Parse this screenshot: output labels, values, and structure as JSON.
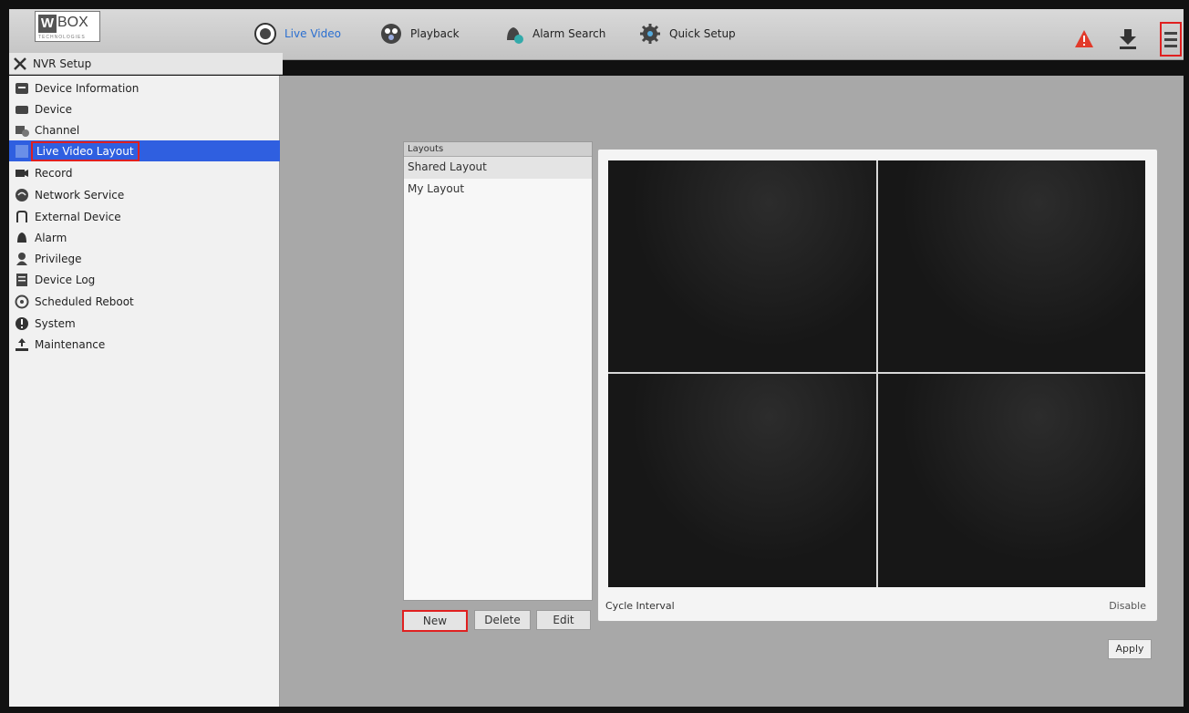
{
  "logo": {
    "mark": "W",
    "name": "BOX",
    "tagline": "TECHNOLOGIES"
  },
  "nav": [
    {
      "label": "Live Video",
      "icon": "live-video-icon",
      "active": true
    },
    {
      "label": "Playback",
      "icon": "playback-icon"
    },
    {
      "label": "Alarm Search",
      "icon": "alarm-search-icon"
    },
    {
      "label": "Quick Setup",
      "icon": "quick-setup-icon"
    }
  ],
  "title": "NVR Setup",
  "sidebar": {
    "items": [
      {
        "label": "Device Information",
        "icon": "device-information-icon"
      },
      {
        "label": "Device",
        "icon": "device-icon"
      },
      {
        "label": "Channel",
        "icon": "channel-icon"
      },
      {
        "label": "Live Video Layout",
        "icon": "live-video-layout-icon",
        "selected": true
      },
      {
        "label": "Record",
        "icon": "record-icon"
      },
      {
        "label": "Network Service",
        "icon": "network-service-icon"
      },
      {
        "label": "External Device",
        "icon": "external-device-icon"
      },
      {
        "label": "Alarm",
        "icon": "alarm-icon"
      },
      {
        "label": "Privilege",
        "icon": "privilege-icon"
      },
      {
        "label": "Device Log",
        "icon": "device-log-icon"
      },
      {
        "label": "Scheduled Reboot",
        "icon": "scheduled-reboot-icon"
      },
      {
        "label": "System",
        "icon": "system-icon"
      },
      {
        "label": "Maintenance",
        "icon": "maintenance-icon"
      }
    ]
  },
  "layouts": {
    "header": "Layouts",
    "items": [
      "Shared Layout",
      "My Layout"
    ],
    "buttons": {
      "new": "New",
      "delete": "Delete",
      "edit": "Edit"
    }
  },
  "preview": {
    "cycle_label": "Cycle Interval",
    "cycle_value": "Disable",
    "apply": "Apply"
  },
  "colors": {
    "accent": "#2f5fe0",
    "highlight": "#e02020",
    "active_nav": "#2a6fd0"
  }
}
